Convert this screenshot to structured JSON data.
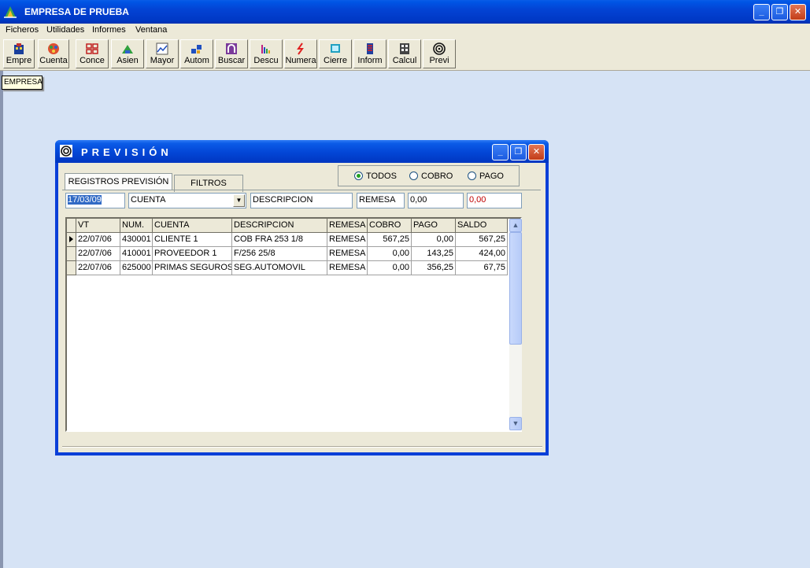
{
  "app": {
    "title": "EMPRESA DE PRUEBA",
    "window_buttons": {
      "minimize": "_",
      "maximize": "❐",
      "close": "✕"
    }
  },
  "menu": [
    "Ficheros",
    "Utilidades",
    "Informes",
    "Ventana"
  ],
  "toolbar": [
    {
      "label": "Empre",
      "icon": "building-icon"
    },
    {
      "label": "Cuenta",
      "icon": "palette-icon"
    },
    {
      "label": "Conce",
      "icon": "grid-icon"
    },
    {
      "label": "Asien",
      "icon": "ledger-icon"
    },
    {
      "label": "Mayor",
      "icon": "chart-icon"
    },
    {
      "label": "Autom",
      "icon": "blocks-icon"
    },
    {
      "label": "Buscar",
      "icon": "magnet-icon"
    },
    {
      "label": "Descu",
      "icon": "bars-icon"
    },
    {
      "label": "Numera",
      "icon": "lightning-icon"
    },
    {
      "label": "Cierre",
      "icon": "screen-icon"
    },
    {
      "label": "Inform",
      "icon": "report-icon"
    },
    {
      "label": "Calcul",
      "icon": "calculator-icon"
    },
    {
      "label": "Previ",
      "icon": "spiral-icon"
    }
  ],
  "tooltip": "EMPRESA",
  "prevision": {
    "title": "PREVISIÓN",
    "tabs": {
      "registros": "REGISTROS PREVISIÓN",
      "filtros": "FILTROS"
    },
    "radios": {
      "todos": "TODOS",
      "cobro": "COBRO",
      "pago": "PAGO",
      "selected": "todos"
    },
    "filters": {
      "date": "17/03/09",
      "cuenta": "CUENTA",
      "descripcion": "DESCRIPCION",
      "remesa": "REMESA",
      "cobro": "0,00",
      "pago": "0,00"
    },
    "colors": {
      "pago_filter_text": "#c00000",
      "selection": "#316ac5"
    },
    "grid": {
      "headers": [
        "VT",
        "NUM.",
        "CUENTA",
        "DESCRIPCION",
        "REMESA",
        "COBRO",
        "PAGO",
        "SALDO"
      ],
      "rows": [
        [
          "22/07/06",
          "430001",
          "CLIENTE 1",
          "COB FRA 253 1/8",
          "REMESA",
          "567,25",
          "0,00",
          "567,25"
        ],
        [
          "22/07/06",
          "410001",
          "PROVEEDOR 1",
          "F/256 25/8",
          "REMESA",
          "0,00",
          "143,25",
          "424,00"
        ],
        [
          "22/07/06",
          "625000",
          "PRIMAS SEGUROS",
          "SEG.AUTOMOVIL",
          "REMESA",
          "0,00",
          "356,25",
          "67,75"
        ]
      ]
    }
  }
}
